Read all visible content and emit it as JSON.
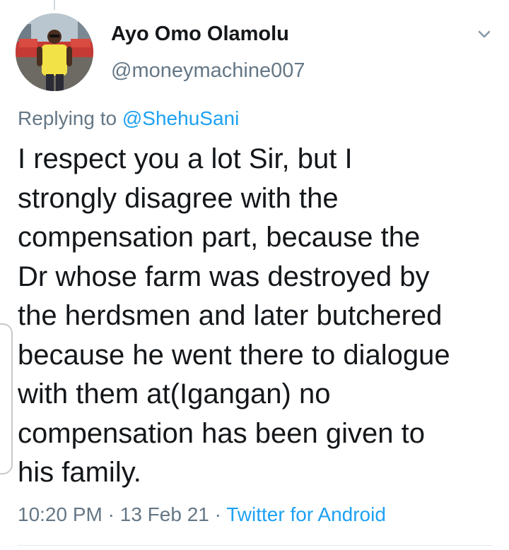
{
  "tweet": {
    "author": {
      "display_name": "Ayo Omo Olamolu",
      "handle": "@moneymachine007"
    },
    "reply_prefix": "Replying to ",
    "reply_to": "@ShehuSani",
    "text_lines": [
      "I respect you a lot Sir, but I",
      "strongly disagree with the",
      "compensation part, because the",
      "Dr whose farm was destroyed by",
      "the herdsmen and later butchered",
      "because he went there to dialogue",
      "with them at(Igangan) no",
      "compensation has been given to",
      "his family."
    ],
    "time": "10:20 PM",
    "date": "13 Feb 21",
    "separator": " · ",
    "source": "Twitter for Android"
  },
  "icons": {
    "menu": "chevron-down-icon"
  },
  "colors": {
    "text": "#14171a",
    "secondary": "#657786",
    "link": "#1da1f2"
  }
}
